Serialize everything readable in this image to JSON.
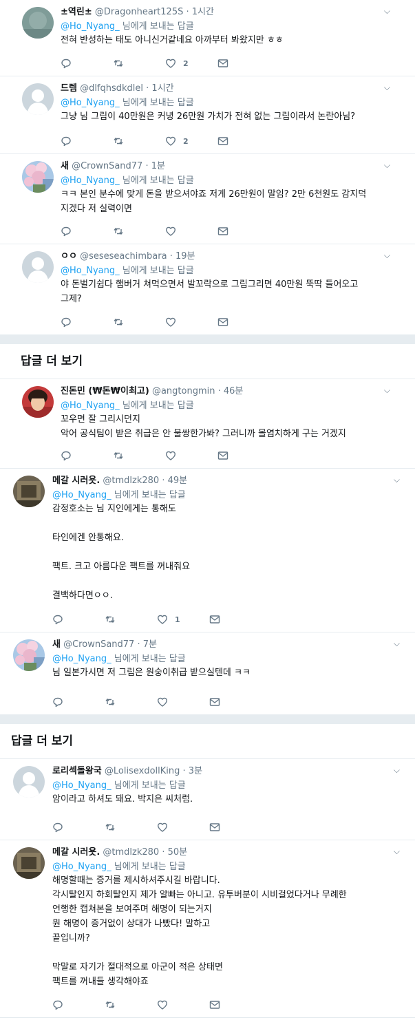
{
  "reply_prefix": "님에게 보내는 답글",
  "more_replies_label": "답글 더 보기",
  "tweets": [
    {
      "name": "±역린±",
      "handle": "@Dragonheart125S",
      "time": "· 1시간",
      "reply_to": "@Ho_Nyang_",
      "text": "전혀 반성하는 태도 아니신거같네요 아까부터 봐왔지만 ㅎㅎ",
      "likes": "2",
      "avatar": "blurred-photo"
    },
    {
      "name": "드렘",
      "handle": "@dlfqhsdkdlel",
      "time": "· 1시간",
      "reply_to": "@Ho_Nyang_",
      "text": "그냥 님 그림이 40만원은 커녕 26만원 가치가 전혀 없는 그림이라서 논란아님?",
      "likes": "2",
      "avatar": "default-egg"
    },
    {
      "name": "새",
      "handle": "@CrownSand77",
      "time": "· 1분",
      "reply_to": "@Ho_Nyang_",
      "text": "ㅋㅋ 본인 분수에 맞게 돈을 받으셔야죠 저게 26만원이 말임? 2만 6천원도 감지덕\n지겠다 저 실력이면",
      "likes": "",
      "avatar": "cherry-blossom"
    },
    {
      "name": "ㅇㅇ",
      "handle": "@seseseachimbara",
      "time": "· 19분",
      "reply_to": "@Ho_Nyang_",
      "text": "야 돈벌기쉽다 햄버거 쳐먹으면서 발꼬락으로 그림그리면 40만원 뚝딱 들어오고\n그제?",
      "likes": "",
      "avatar": "default-egg"
    },
    {
      "name": "진돈민 (₩돈₩이최고)",
      "handle": "@angtongmin",
      "time": "· 46분",
      "reply_to": "@Ho_Nyang_",
      "text": "꼬우면 잘 그리시던지\n악어 공식팀이 받은 취급은 안 불쌍한가봐? 그러니까 몰염치하게 구는 거겠지",
      "likes": "",
      "avatar": "person-photo"
    },
    {
      "name": "메갈 시러욧.",
      "handle": "@tmdlzk280",
      "time": "· 49분",
      "reply_to": "@Ho_Nyang_",
      "text": "감정호소는 님 지인에게는 통해도\n\n타인에겐 안통해요.\n\n팩트. 크고 아름다운 팩트를 꺼내줘요\n\n결백하다면ㅇㅇ.",
      "likes": "1",
      "avatar": "dark-photo"
    },
    {
      "name": "새",
      "handle": "@CrownSand77",
      "time": "· 7분",
      "reply_to": "@Ho_Nyang_",
      "text": "님 일본가시면 저 그림은 원숭이취급 받으실텐데 ㅋㅋ",
      "likes": "",
      "avatar": "cherry-blossom"
    },
    {
      "name": "로리섹돌왕국",
      "handle": "@LolisexdollKing",
      "time": "· 3분",
      "reply_to": "@Ho_Nyang_",
      "text": "암이라고 하셔도 돼요. 박지은 씨처럼.",
      "likes": "",
      "avatar": "default-egg"
    },
    {
      "name": "메갈 시러욧.",
      "handle": "@tmdlzk280",
      "time": "· 50분",
      "reply_to": "@Ho_Nyang_",
      "text": "해명할때는 증거를 제시하셔주시길 바랍니다.\n각시탈인지 하회탈인지 제가 알빠는 아니고. 유투버분이 시비걸었다거나 무례한\n언행한 캡쳐본을 보여주며 해명이 되는거지\n뭔 해명이 증거없이 상대가 나빴다! 말하고\n끝입니까?\n\n막말로 자기가 절대적으로 아군이 적은 상태면\n팩트를 꺼내들 생각해야죠",
      "likes": "",
      "avatar": "dark-photo"
    }
  ]
}
